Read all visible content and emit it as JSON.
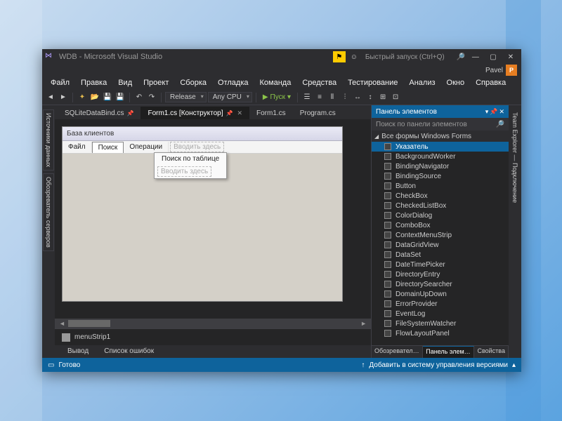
{
  "title": "WDB - Microsoft Visual Studio",
  "quick_launch_placeholder": "Быстрый запуск (Ctrl+Q)",
  "user_name": "Pavel",
  "user_initial": "P",
  "menu": [
    "Файл",
    "Правка",
    "Вид",
    "Проект",
    "Сборка",
    "Отладка",
    "Команда",
    "Средства",
    "Тестирование",
    "Анализ",
    "Окно",
    "Справка"
  ],
  "toolbar": {
    "config": "Release",
    "platform": "Any CPU",
    "start_label": "Пуск"
  },
  "left_rails": [
    "Источники данных",
    "Обозреватель серверов"
  ],
  "right_rail": "Team Explorer — Подключение",
  "doc_tabs": [
    {
      "label": "SQLiteDataBind.cs",
      "locked": true,
      "active": false
    },
    {
      "label": "Form1.cs [Конструктор]",
      "locked": true,
      "active": true
    },
    {
      "label": "Form1.cs",
      "locked": false,
      "active": false
    },
    {
      "label": "Program.cs",
      "locked": false,
      "active": false
    }
  ],
  "form": {
    "title": "База клиентов",
    "menu": [
      "Файл",
      "Поиск",
      "Операции"
    ],
    "menu_selected": 1,
    "menu_ghost": "Вводить здесь",
    "dropdown_item": "Поиск по таблице",
    "dropdown_ghost": "Вводить здесь"
  },
  "tray_item": "menuStrip1",
  "bottom_tabs": [
    "Вывод",
    "Список ошибок"
  ],
  "toolbox": {
    "title": "Панель элементов",
    "search_placeholder": "Поиск по панели элементов",
    "group": "Все формы Windows Forms",
    "items": [
      "Указатель",
      "BackgroundWorker",
      "BindingNavigator",
      "BindingSource",
      "Button",
      "CheckBox",
      "CheckedListBox",
      "ColorDialog",
      "ComboBox",
      "ContextMenuStrip",
      "DataGridView",
      "DataSet",
      "DateTimePicker",
      "DirectoryEntry",
      "DirectorySearcher",
      "DomainUpDown",
      "ErrorProvider",
      "EventLog",
      "FileSystemWatcher",
      "FlowLayoutPanel"
    ],
    "selected_index": 0,
    "bottom_tabs": [
      "Обозреватель р...",
      "Панель элемент...",
      "Свойства"
    ],
    "bottom_active": 1
  },
  "status": {
    "ready": "Готово",
    "vcs": "Добавить в систему управления версиями"
  }
}
